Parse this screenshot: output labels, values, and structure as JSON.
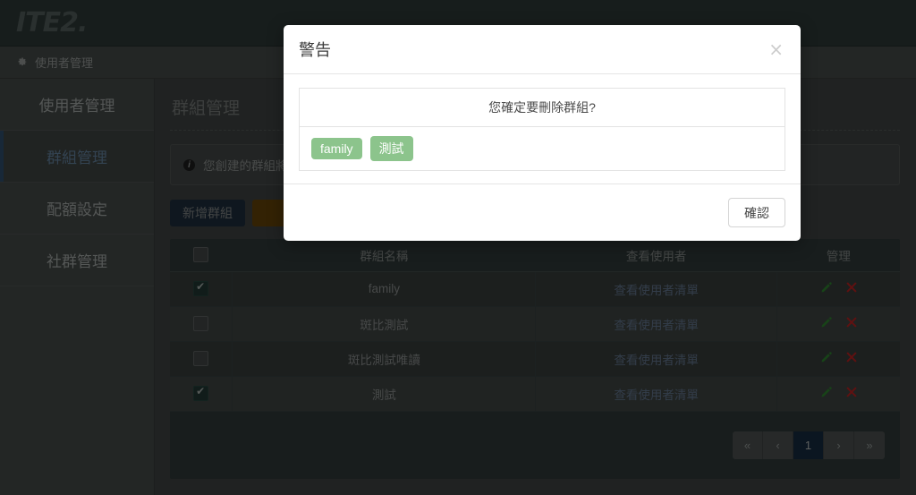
{
  "header": {
    "logo_text": "ITE2",
    "logo_dot": ".",
    "breadcrumb_label": "使用者管理",
    "gear_icon": "gear-icon"
  },
  "sidebar": {
    "items": [
      {
        "label": "使用者管理",
        "active": false
      },
      {
        "label": "群組管理",
        "active": true
      },
      {
        "label": "配額設定",
        "active": false
      },
      {
        "label": "社群管理",
        "active": false
      }
    ]
  },
  "main": {
    "page_title": "群組管理",
    "alert": {
      "icon": "info-icon",
      "text": "您創建的群組將"
    },
    "toolbar": {
      "add_group_label": "新增群組",
      "secondary_label": ""
    },
    "table": {
      "columns": [
        "",
        "群組名稱",
        "查看使用者",
        "管理"
      ],
      "rows": [
        {
          "checked": true,
          "name": "family",
          "view_link": "查看使用者清單",
          "edit_icon": "pencil-icon",
          "delete_icon": "x-icon"
        },
        {
          "checked": false,
          "name": "斑比測試",
          "view_link": "查看使用者清單",
          "edit_icon": "pencil-icon",
          "delete_icon": "x-icon"
        },
        {
          "checked": false,
          "name": "斑比測試唯讀",
          "view_link": "查看使用者清單",
          "edit_icon": "pencil-icon",
          "delete_icon": "x-icon"
        },
        {
          "checked": true,
          "name": "測試",
          "view_link": "查看使用者清單",
          "edit_icon": "pencil-icon",
          "delete_icon": "x-icon"
        }
      ]
    },
    "pagination": {
      "first": "«",
      "prev": "‹",
      "current_page": "1",
      "next": "›",
      "last": "»"
    }
  },
  "modal": {
    "title": "警告",
    "close_icon": "×",
    "message": "您確定要刪除群組?",
    "badges": [
      "family",
      "測試"
    ],
    "confirm_label": "確認"
  },
  "colors": {
    "topbar_bg": "#2b3534",
    "sidebar_bg": "#414544",
    "active_accent": "#2c4a66",
    "badge_green": "#8cc48c",
    "primary_btn": "#1d2b3a",
    "warning_btn": "#5e3f08",
    "link_blue": "#5d6f87",
    "pencil_green": "#2d7a2d",
    "delete_red": "#b01f1f"
  }
}
